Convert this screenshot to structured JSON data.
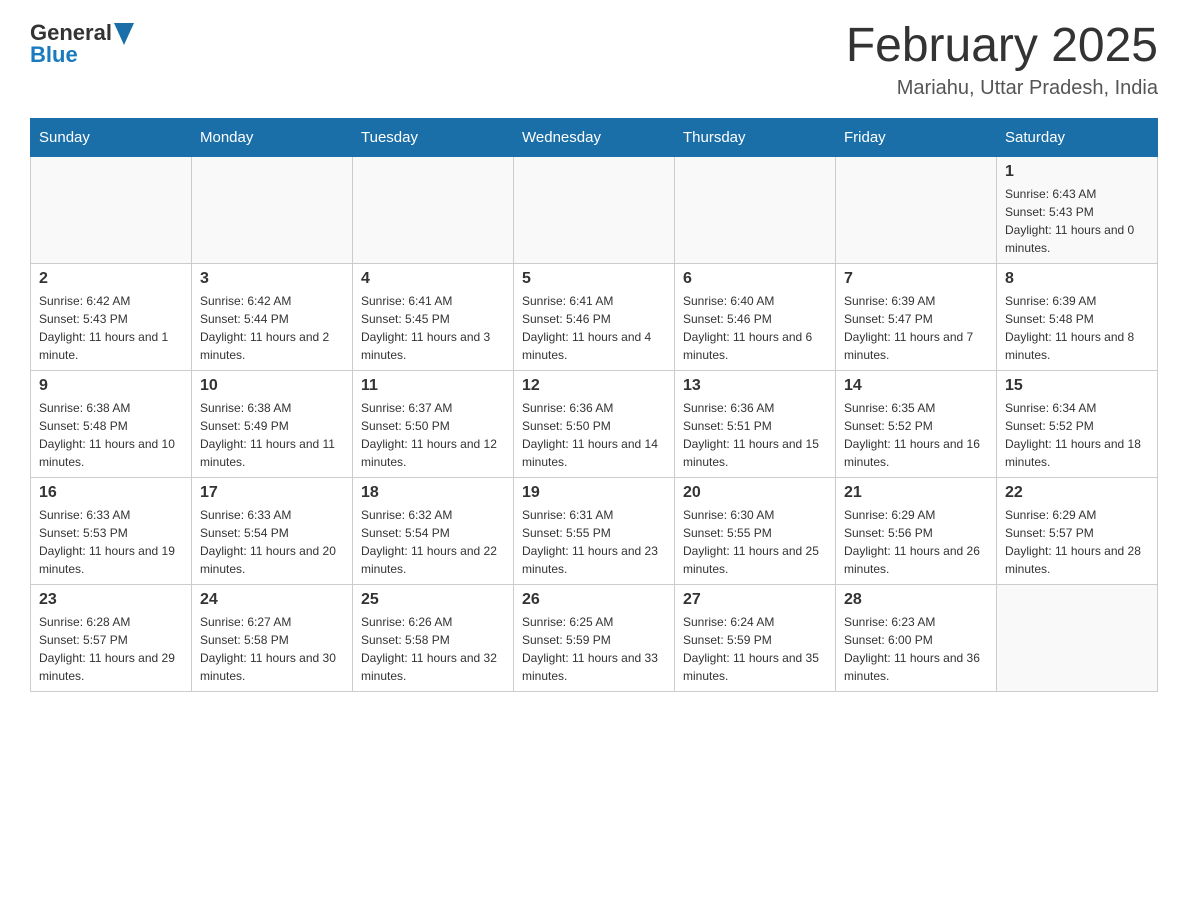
{
  "logo": {
    "text_general": "General",
    "text_blue": "Blue"
  },
  "title": {
    "month": "February 2025",
    "location": "Mariahu, Uttar Pradesh, India"
  },
  "days_of_week": [
    "Sunday",
    "Monday",
    "Tuesday",
    "Wednesday",
    "Thursday",
    "Friday",
    "Saturday"
  ],
  "weeks": [
    [
      {
        "day": "",
        "info": ""
      },
      {
        "day": "",
        "info": ""
      },
      {
        "day": "",
        "info": ""
      },
      {
        "day": "",
        "info": ""
      },
      {
        "day": "",
        "info": ""
      },
      {
        "day": "",
        "info": ""
      },
      {
        "day": "1",
        "info": "Sunrise: 6:43 AM\nSunset: 5:43 PM\nDaylight: 11 hours and 0 minutes."
      }
    ],
    [
      {
        "day": "2",
        "info": "Sunrise: 6:42 AM\nSunset: 5:43 PM\nDaylight: 11 hours and 1 minute."
      },
      {
        "day": "3",
        "info": "Sunrise: 6:42 AM\nSunset: 5:44 PM\nDaylight: 11 hours and 2 minutes."
      },
      {
        "day": "4",
        "info": "Sunrise: 6:41 AM\nSunset: 5:45 PM\nDaylight: 11 hours and 3 minutes."
      },
      {
        "day": "5",
        "info": "Sunrise: 6:41 AM\nSunset: 5:46 PM\nDaylight: 11 hours and 4 minutes."
      },
      {
        "day": "6",
        "info": "Sunrise: 6:40 AM\nSunset: 5:46 PM\nDaylight: 11 hours and 6 minutes."
      },
      {
        "day": "7",
        "info": "Sunrise: 6:39 AM\nSunset: 5:47 PM\nDaylight: 11 hours and 7 minutes."
      },
      {
        "day": "8",
        "info": "Sunrise: 6:39 AM\nSunset: 5:48 PM\nDaylight: 11 hours and 8 minutes."
      }
    ],
    [
      {
        "day": "9",
        "info": "Sunrise: 6:38 AM\nSunset: 5:48 PM\nDaylight: 11 hours and 10 minutes."
      },
      {
        "day": "10",
        "info": "Sunrise: 6:38 AM\nSunset: 5:49 PM\nDaylight: 11 hours and 11 minutes."
      },
      {
        "day": "11",
        "info": "Sunrise: 6:37 AM\nSunset: 5:50 PM\nDaylight: 11 hours and 12 minutes."
      },
      {
        "day": "12",
        "info": "Sunrise: 6:36 AM\nSunset: 5:50 PM\nDaylight: 11 hours and 14 minutes."
      },
      {
        "day": "13",
        "info": "Sunrise: 6:36 AM\nSunset: 5:51 PM\nDaylight: 11 hours and 15 minutes."
      },
      {
        "day": "14",
        "info": "Sunrise: 6:35 AM\nSunset: 5:52 PM\nDaylight: 11 hours and 16 minutes."
      },
      {
        "day": "15",
        "info": "Sunrise: 6:34 AM\nSunset: 5:52 PM\nDaylight: 11 hours and 18 minutes."
      }
    ],
    [
      {
        "day": "16",
        "info": "Sunrise: 6:33 AM\nSunset: 5:53 PM\nDaylight: 11 hours and 19 minutes."
      },
      {
        "day": "17",
        "info": "Sunrise: 6:33 AM\nSunset: 5:54 PM\nDaylight: 11 hours and 20 minutes."
      },
      {
        "day": "18",
        "info": "Sunrise: 6:32 AM\nSunset: 5:54 PM\nDaylight: 11 hours and 22 minutes."
      },
      {
        "day": "19",
        "info": "Sunrise: 6:31 AM\nSunset: 5:55 PM\nDaylight: 11 hours and 23 minutes."
      },
      {
        "day": "20",
        "info": "Sunrise: 6:30 AM\nSunset: 5:55 PM\nDaylight: 11 hours and 25 minutes."
      },
      {
        "day": "21",
        "info": "Sunrise: 6:29 AM\nSunset: 5:56 PM\nDaylight: 11 hours and 26 minutes."
      },
      {
        "day": "22",
        "info": "Sunrise: 6:29 AM\nSunset: 5:57 PM\nDaylight: 11 hours and 28 minutes."
      }
    ],
    [
      {
        "day": "23",
        "info": "Sunrise: 6:28 AM\nSunset: 5:57 PM\nDaylight: 11 hours and 29 minutes."
      },
      {
        "day": "24",
        "info": "Sunrise: 6:27 AM\nSunset: 5:58 PM\nDaylight: 11 hours and 30 minutes."
      },
      {
        "day": "25",
        "info": "Sunrise: 6:26 AM\nSunset: 5:58 PM\nDaylight: 11 hours and 32 minutes."
      },
      {
        "day": "26",
        "info": "Sunrise: 6:25 AM\nSunset: 5:59 PM\nDaylight: 11 hours and 33 minutes."
      },
      {
        "day": "27",
        "info": "Sunrise: 6:24 AM\nSunset: 5:59 PM\nDaylight: 11 hours and 35 minutes."
      },
      {
        "day": "28",
        "info": "Sunrise: 6:23 AM\nSunset: 6:00 PM\nDaylight: 11 hours and 36 minutes."
      },
      {
        "day": "",
        "info": ""
      }
    ]
  ]
}
